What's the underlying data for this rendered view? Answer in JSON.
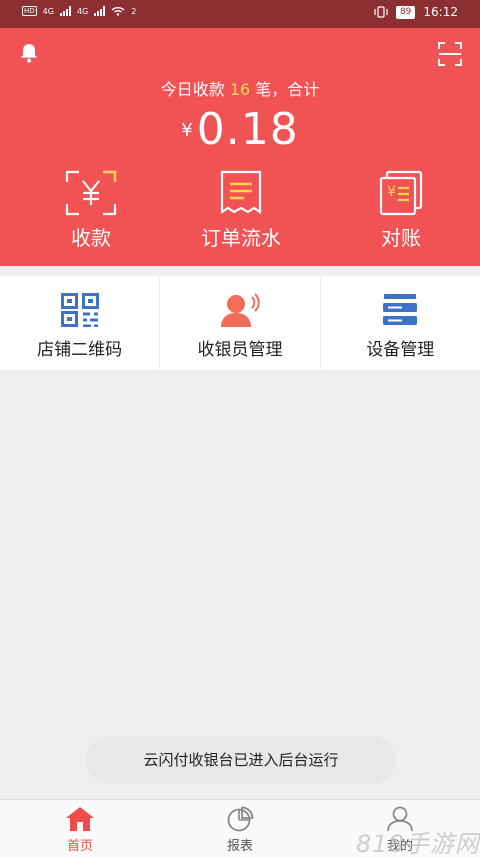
{
  "statusbar": {
    "left_indicators": [
      "HD",
      "4G",
      "4G",
      "2"
    ],
    "battery": "89",
    "time": "16:12"
  },
  "header": {
    "today_prefix": "今日收款",
    "today_count": "16",
    "today_suffix": "笔，合计",
    "currency": "¥",
    "amount": "0.18",
    "actions": [
      {
        "label": "收款",
        "icon": "scan-yen-icon"
      },
      {
        "label": "订单流水",
        "icon": "receipt-icon"
      },
      {
        "label": "对账",
        "icon": "reconcile-icon"
      }
    ]
  },
  "grid": [
    {
      "label": "店铺二维码",
      "icon": "qr-code-icon",
      "color": "#3c73c7"
    },
    {
      "label": "收银员管理",
      "icon": "cashier-icon",
      "color": "#f26c5a"
    },
    {
      "label": "设备管理",
      "icon": "device-icon",
      "color": "#3c73c7"
    }
  ],
  "toast": "云闪付收银台已进入后台运行",
  "tabbar": [
    {
      "label": "首页",
      "icon": "home-icon",
      "active": true
    },
    {
      "label": "报表",
      "icon": "pie-chart-icon",
      "active": false
    },
    {
      "label": "我的",
      "icon": "user-icon",
      "active": false
    }
  ],
  "watermark": "818手游网",
  "colors": {
    "brand": "#f15253",
    "statusbar": "#8c2f31",
    "highlight": "#ffd84a",
    "accent_blue": "#3c73c7"
  }
}
